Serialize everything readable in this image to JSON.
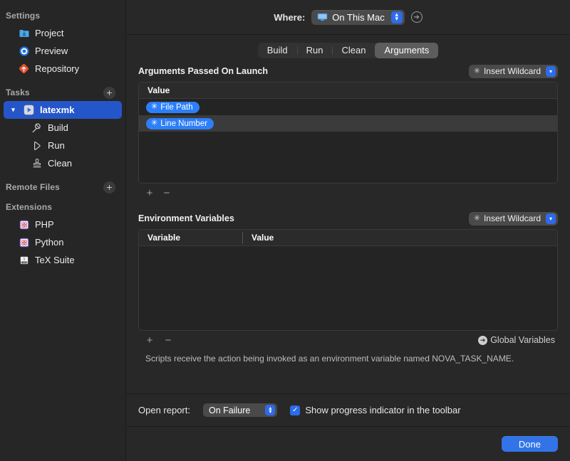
{
  "sidebar": {
    "groups": [
      {
        "title": "Settings",
        "has_add": false,
        "items": [
          {
            "label": "Project",
            "icon": "folder-download-icon"
          },
          {
            "label": "Preview",
            "icon": "preview-circle-icon"
          },
          {
            "label": "Repository",
            "icon": "repository-merge-icon"
          }
        ]
      },
      {
        "title": "Tasks",
        "has_add": true,
        "add_label": "+",
        "items": [
          {
            "label": "latexmk",
            "icon": "play-badge-icon",
            "selected": true,
            "expanded": true
          },
          {
            "label": "Build",
            "icon": "hammer-icon"
          },
          {
            "label": "Run",
            "icon": "play-outline-icon"
          },
          {
            "label": "Clean",
            "icon": "stamp-icon"
          }
        ]
      },
      {
        "title": "Remote Files",
        "has_add": true,
        "add_label": "+",
        "items": []
      },
      {
        "title": "Extensions",
        "has_add": false,
        "items": [
          {
            "label": "PHP",
            "icon": "extension-php-icon"
          },
          {
            "label": "Python",
            "icon": "extension-python-icon"
          },
          {
            "label": "TeX Suite",
            "icon": "extension-tex-icon"
          }
        ]
      }
    ]
  },
  "header": {
    "where_label": "Where:",
    "where_value": "On This Mac",
    "where_icon": "imac-icon",
    "goto_icon": "arrow-right-circle-icon"
  },
  "tabs": [
    {
      "label": "Build",
      "active": false
    },
    {
      "label": "Run",
      "active": false
    },
    {
      "label": "Clean",
      "active": false
    },
    {
      "label": "Arguments",
      "active": true
    }
  ],
  "arguments_section": {
    "title": "Arguments Passed On Launch",
    "wildcard_button": {
      "label": "Insert Wildcard",
      "icon": "asterisk-icon",
      "chevron": "chevron-down-icon"
    },
    "columns": [
      "Value"
    ],
    "rows": [
      {
        "token": "File Path",
        "selected": false
      },
      {
        "token": "Line Number",
        "selected": true
      }
    ],
    "add_label": "+",
    "remove_label": "−"
  },
  "environment_section": {
    "title": "Environment Variables",
    "wildcard_button": {
      "label": "Insert Wildcard",
      "icon": "asterisk-icon",
      "chevron": "chevron-down-icon"
    },
    "columns": [
      "Variable",
      "Value"
    ],
    "rows": [],
    "add_label": "+",
    "remove_label": "−",
    "global_link": "Global Variables",
    "note": "Scripts receive the action being invoked as an environment variable named NOVA_TASK_NAME."
  },
  "footer": {
    "open_report_label": "Open report:",
    "open_report_value": "On Failure",
    "progress_checkbox_label": "Show progress indicator in the toolbar",
    "progress_checked": true,
    "done_label": "Done"
  },
  "colors": {
    "accent": "#2d6bea",
    "selection": "#2556c9",
    "token": "#2d7ff9",
    "window_bg": "#282828",
    "sidebar_bg": "#262626"
  }
}
